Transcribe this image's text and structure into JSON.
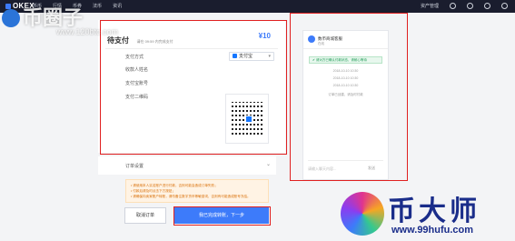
{
  "topbar": {
    "brand": "OKEX",
    "nav": [
      "币币",
      "行情",
      "币券",
      "法币",
      "资讯"
    ],
    "right_label": "资产管理"
  },
  "payment": {
    "title": "待支付",
    "subtitle": "请在 09:59 内完成支付",
    "amount": "¥10",
    "method_label": "支付方式",
    "method_value": "支付宝",
    "payee_label": "收款人姓名",
    "account_label": "支付宝账号",
    "qr_label": "支付二维码"
  },
  "orders": {
    "label": "订单设置"
  },
  "notice": {
    "lines": [
      "• 请使用本人实名账户进行付款，否则可能会造成订单失败；",
      "• 付款后请及时点击下方按钮；",
      "• 请确保向卖家账户转账，请勿备注数字货币等敏感词，否则有可能造成账号冻结。"
    ]
  },
  "buttons": {
    "cancel": "取消订单",
    "confirm": "我已完成转账，下一步"
  },
  "chat": {
    "name": "数币商城客服",
    "sub": "在线",
    "banner": "✔ 请对方已确认付款状态，请耐心等待",
    "times": [
      "2018-10-10 10:30",
      "2018-10-10 10:30",
      "2018-10-10 10:30"
    ],
    "last": "订单已创建，请及时付款",
    "input_placeholder": "请输入聊天内容...",
    "send": "发送"
  },
  "watermarks": {
    "left_title": "币圈子",
    "left_url": "www.120btc.com",
    "right_title": "币大师",
    "right_url": "www.99hufu.com"
  },
  "colors": {
    "accent": "#3d7bfa",
    "highlight": "#e02020",
    "topbar": "#1a1d2e"
  }
}
